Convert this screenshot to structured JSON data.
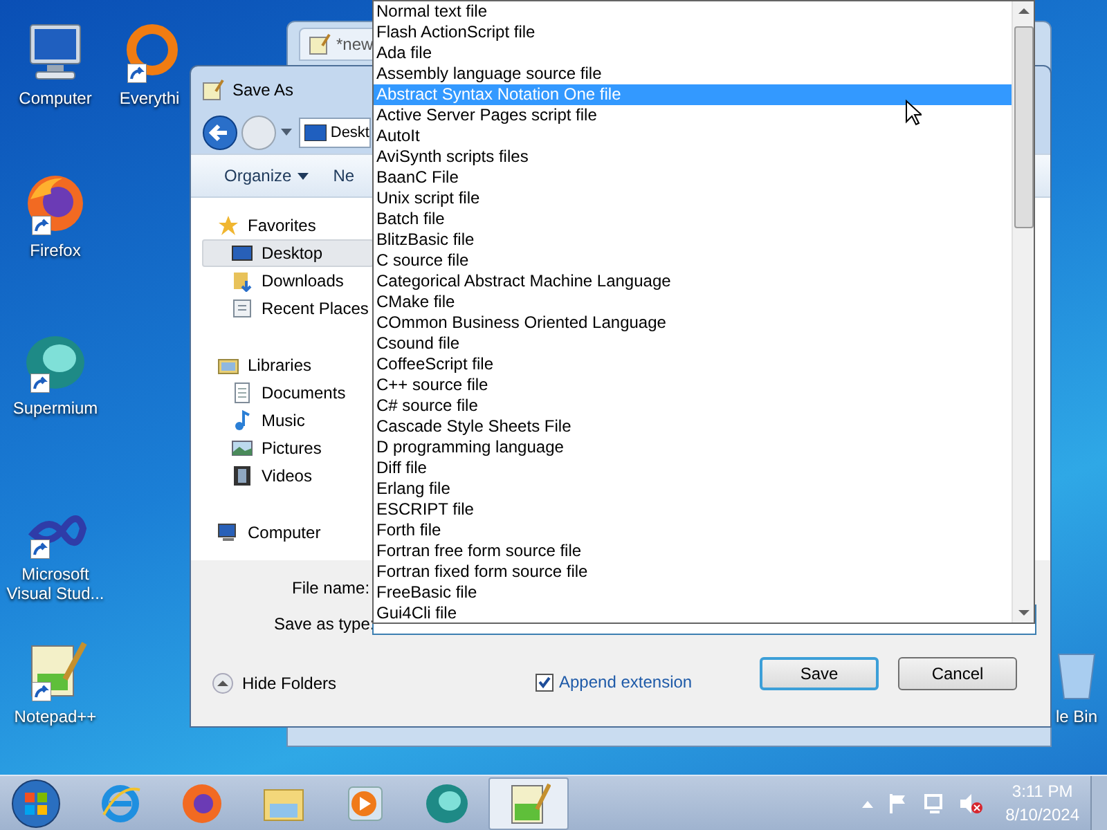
{
  "desktop_icons": [
    {
      "label": "Computer",
      "kind": "computer"
    },
    {
      "label": "Everythi",
      "kind": "everything"
    },
    {
      "label": "Firefox",
      "kind": "firefox"
    },
    {
      "label": "Supermium",
      "kind": "supermium"
    },
    {
      "label": "Microsoft Visual Stud...",
      "kind": "vs"
    },
    {
      "label": "Notepad++",
      "kind": "notepad"
    },
    {
      "label": "le Bin",
      "kind": "bin"
    }
  ],
  "background_window": {
    "tab": "*new"
  },
  "dialog": {
    "title": "Save As",
    "address": "Deskt",
    "toolbar": [
      "Organize",
      "Ne"
    ],
    "nav": [
      {
        "label": "Favorites",
        "kind": "star",
        "children": [
          {
            "label": "Desktop",
            "kind": "desktop",
            "selected": true
          },
          {
            "label": "Downloads",
            "kind": "downloads",
            "selected": false
          },
          {
            "label": "Recent Places",
            "kind": "recent",
            "selected": false
          }
        ]
      },
      {
        "label": "Libraries",
        "kind": "library",
        "children": [
          {
            "label": "Documents",
            "kind": "documents",
            "selected": false
          },
          {
            "label": "Music",
            "kind": "music",
            "selected": false
          },
          {
            "label": "Pictures",
            "kind": "pictures",
            "selected": false
          },
          {
            "label": "Videos",
            "kind": "videos",
            "selected": false
          }
        ]
      },
      {
        "label": "Computer",
        "kind": "computer"
      }
    ],
    "file_name_label": "File name:",
    "save_type_label": "Save as type:",
    "hide_folders": "Hide Folders",
    "append_extension": {
      "label": "Append extension",
      "checked": true
    },
    "buttons": [
      "Save",
      "Cancel"
    ]
  },
  "type_list": {
    "items": [
      {
        "label": "Normal text file",
        "selected": false
      },
      {
        "label": "Flash ActionScript file",
        "selected": false
      },
      {
        "label": "Ada file",
        "selected": false
      },
      {
        "label": "Assembly language source file",
        "selected": false
      },
      {
        "label": "Abstract Syntax Notation One file",
        "selected": true
      },
      {
        "label": "Active Server Pages script file",
        "selected": false
      },
      {
        "label": "AutoIt",
        "selected": false
      },
      {
        "label": "AviSynth scripts files",
        "selected": false
      },
      {
        "label": "BaanC File",
        "selected": false
      },
      {
        "label": "Unix script file",
        "selected": false
      },
      {
        "label": "Batch file",
        "selected": false
      },
      {
        "label": "BlitzBasic file",
        "selected": false
      },
      {
        "label": "C source file",
        "selected": false
      },
      {
        "label": "Categorical Abstract Machine Language",
        "selected": false
      },
      {
        "label": "CMake file",
        "selected": false
      },
      {
        "label": "COmmon Business Oriented Language",
        "selected": false
      },
      {
        "label": "Csound file",
        "selected": false
      },
      {
        "label": "CoffeeScript file",
        "selected": false
      },
      {
        "label": "C++ source file",
        "selected": false
      },
      {
        "label": "C# source file",
        "selected": false
      },
      {
        "label": "Cascade Style Sheets File",
        "selected": false
      },
      {
        "label": "D programming language",
        "selected": false
      },
      {
        "label": "Diff file",
        "selected": false
      },
      {
        "label": "Erlang file",
        "selected": false
      },
      {
        "label": "ESCRIPT file",
        "selected": false
      },
      {
        "label": "Forth file",
        "selected": false
      },
      {
        "label": "Fortran free form source file",
        "selected": false
      },
      {
        "label": "Fortran fixed form source file",
        "selected": false
      },
      {
        "label": "FreeBasic file",
        "selected": false
      },
      {
        "label": "Gui4Cli file",
        "selected": false
      }
    ]
  },
  "taskbar": {
    "apps": [
      {
        "kind": "ie",
        "active": false
      },
      {
        "kind": "firefox",
        "active": false
      },
      {
        "kind": "explorer",
        "active": false
      },
      {
        "kind": "media",
        "active": false
      },
      {
        "kind": "supermium",
        "active": false
      },
      {
        "kind": "notepad",
        "active": true
      }
    ],
    "time": "3:11 PM",
    "date": "8/10/2024"
  }
}
